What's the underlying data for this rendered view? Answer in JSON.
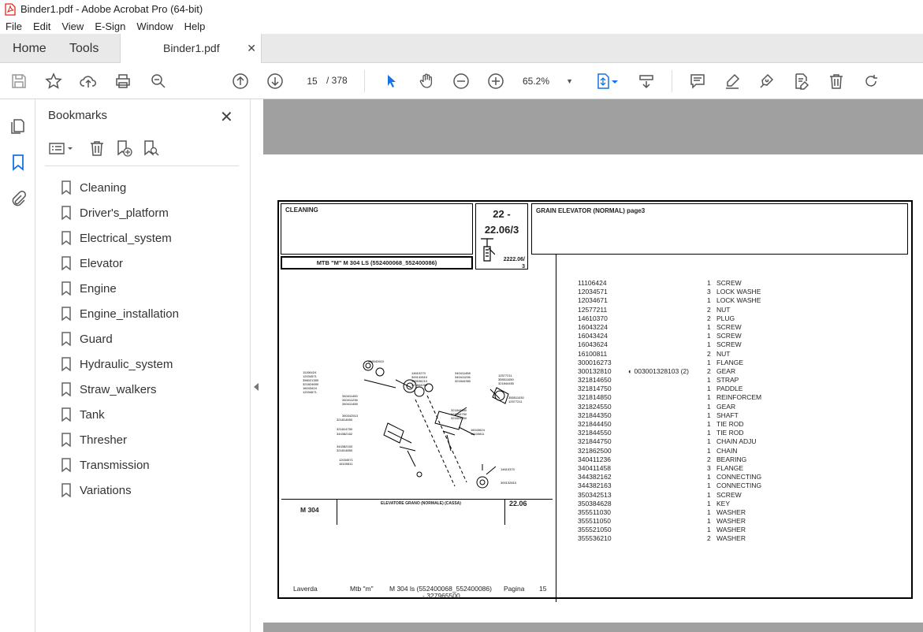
{
  "window": {
    "title": "Binder1.pdf - Adobe Acrobat Pro (64-bit)"
  },
  "menu": [
    "File",
    "Edit",
    "View",
    "E-Sign",
    "Window",
    "Help"
  ],
  "tabs": {
    "home": "Home",
    "tools": "Tools",
    "document": "Binder1.pdf"
  },
  "toolbar": {
    "current_page": "15",
    "total_pages": "/ 378",
    "zoom": "65.2%"
  },
  "bookmarks": {
    "title": "Bookmarks",
    "items": [
      "Cleaning",
      "Driver's_platform",
      "Electrical_system",
      "Elevator",
      "Engine",
      "Engine_installation",
      "Guard",
      "Hydraulic_system",
      "Straw_walkers",
      "Tank",
      "Thresher",
      "Transmission",
      "Variations"
    ]
  },
  "document": {
    "section": "CLEANING",
    "model_line": "MTB \"M\" M 304 LS (552400068_552400086)",
    "ref_top": "22 -",
    "ref_bottom": "22.06/3",
    "ref_small": "2222.06/\n3",
    "title": "GRAIN ELEVATOR (NORMAL) page3",
    "legend": {
      "model": "M 304",
      "caption": "ELEVATORE GRANO (NORMALE) (CASSA)",
      "ref": "22.06"
    },
    "footer": {
      "brand": "Laverda",
      "series": "Mtb \"m\"",
      "model": "M 304 ls (552400068_552400086)",
      "code": "- 327965500",
      "page_label": "Pagina",
      "page_num": "15"
    },
    "parts": [
      {
        "code": "11106424",
        "alt": "",
        "qty": "1",
        "desc": "SCREW"
      },
      {
        "code": "12034571",
        "alt": "",
        "qty": "3",
        "desc": "LOCK WASHE"
      },
      {
        "code": "12034671",
        "alt": "",
        "qty": "1",
        "desc": "LOCK WASHE"
      },
      {
        "code": "12577211",
        "alt": "",
        "qty": "2",
        "desc": "NUT"
      },
      {
        "code": "14610370",
        "alt": "",
        "qty": "2",
        "desc": "PLUG"
      },
      {
        "code": "16043224",
        "alt": "",
        "qty": "1",
        "desc": "SCREW"
      },
      {
        "code": "16043424",
        "alt": "",
        "qty": "1",
        "desc": "SCREW"
      },
      {
        "code": "16043624",
        "alt": "",
        "qty": "1",
        "desc": "SCREW"
      },
      {
        "code": "16100811",
        "alt": "",
        "qty": "2",
        "desc": "NUT"
      },
      {
        "code": "300016273",
        "alt": "",
        "qty": "1",
        "desc": "FLANGE"
      },
      {
        "code": "300132810",
        "alt": "003001328103  (2)",
        "qty": "2",
        "desc": "GEAR"
      },
      {
        "code": "321814650",
        "alt": "",
        "qty": "1",
        "desc": "STRAP"
      },
      {
        "code": "321814750",
        "alt": "",
        "qty": "1",
        "desc": "PADDLE"
      },
      {
        "code": "321814850",
        "alt": "",
        "qty": "1",
        "desc": "REINFORCEM"
      },
      {
        "code": "321824550",
        "alt": "",
        "qty": "1",
        "desc": "GEAR"
      },
      {
        "code": "321844350",
        "alt": "",
        "qty": "1",
        "desc": "SHAFT"
      },
      {
        "code": "321844450",
        "alt": "",
        "qty": "1",
        "desc": "TIE ROD"
      },
      {
        "code": "321844550",
        "alt": "",
        "qty": "1",
        "desc": "TIE ROD"
      },
      {
        "code": "321844750",
        "alt": "",
        "qty": "1",
        "desc": "CHAIN ADJU"
      },
      {
        "code": "321862500",
        "alt": "",
        "qty": "1",
        "desc": "CHAIN"
      },
      {
        "code": "340411236",
        "alt": "",
        "qty": "2",
        "desc": "BEARING"
      },
      {
        "code": "340411458",
        "alt": "",
        "qty": "3",
        "desc": "FLANGE"
      },
      {
        "code": "344382162",
        "alt": "",
        "qty": "1",
        "desc": "CONNECTING"
      },
      {
        "code": "344382163",
        "alt": "",
        "qty": "1",
        "desc": "CONNECTING"
      },
      {
        "code": "350342513",
        "alt": "",
        "qty": "1",
        "desc": "SCREW"
      },
      {
        "code": "350384628",
        "alt": "",
        "qty": "1",
        "desc": "KEY"
      },
      {
        "code": "355511030",
        "alt": "",
        "qty": "1",
        "desc": "WASHER"
      },
      {
        "code": "355511050",
        "alt": "",
        "qty": "1",
        "desc": "WASHER"
      },
      {
        "code": "355521050",
        "alt": "",
        "qty": "1",
        "desc": "WASHER"
      },
      {
        "code": "355536210",
        "alt": "",
        "qty": "2",
        "desc": "WASHER"
      }
    ]
  },
  "colors": {
    "accent_blue": "#1473e6",
    "viewer_gray": "#a0a0a0",
    "acrobat_red": "#e0261b"
  }
}
